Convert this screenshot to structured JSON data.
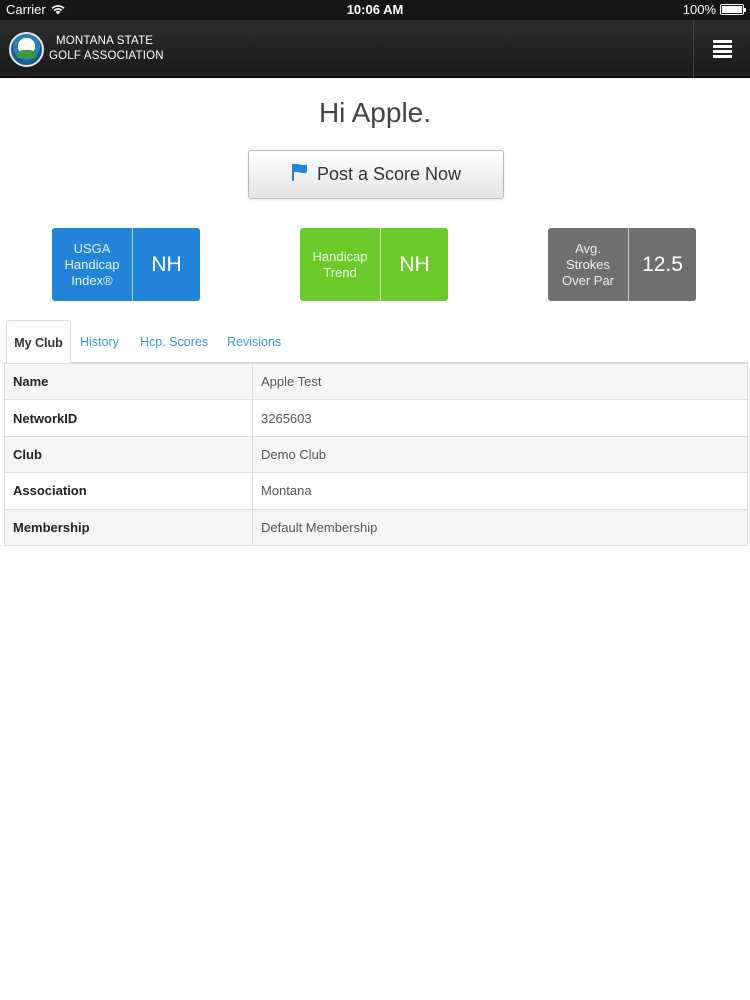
{
  "status_bar": {
    "carrier": "Carrier",
    "time": "10:06 AM",
    "battery": "100%",
    "battery_level": 1.0
  },
  "nav": {
    "brand_line1": "MONTANA STATE",
    "brand_line2": "GOLF ASSOCIATION",
    "logo_icon": "association-logo",
    "menu_icon": "hamburger-menu-icon"
  },
  "greeting": "Hi Apple.",
  "post_score": {
    "label": "Post a Score Now",
    "icon": "flag-icon",
    "icon_color": "#2284d6"
  },
  "stats": [
    {
      "label": "USGA Handicap Index®",
      "value": "NH",
      "color": "#2284d6"
    },
    {
      "label": "Handicap Trend",
      "value": "NH",
      "color": "#6ccb2a"
    },
    {
      "label": "Avg. Strokes Over Par",
      "value": "12.5",
      "color": "#6f6f6f"
    }
  ],
  "tabs": [
    {
      "label": "My Club",
      "active": true
    },
    {
      "label": "History",
      "active": false
    },
    {
      "label": "Hcp. Scores",
      "active": false
    },
    {
      "label": "Revisions",
      "active": false
    }
  ],
  "table": {
    "rows": [
      {
        "key": "Name",
        "value": "Apple Test"
      },
      {
        "key": "NetworkID",
        "value": "3265603"
      },
      {
        "key": "Club",
        "value": "Demo Club"
      },
      {
        "key": "Association",
        "value": "Montana"
      },
      {
        "key": "Membership",
        "value": "Default Membership"
      }
    ]
  },
  "colors": {
    "link": "#3a9bd6",
    "nav_bg": "#1f1f1f"
  }
}
